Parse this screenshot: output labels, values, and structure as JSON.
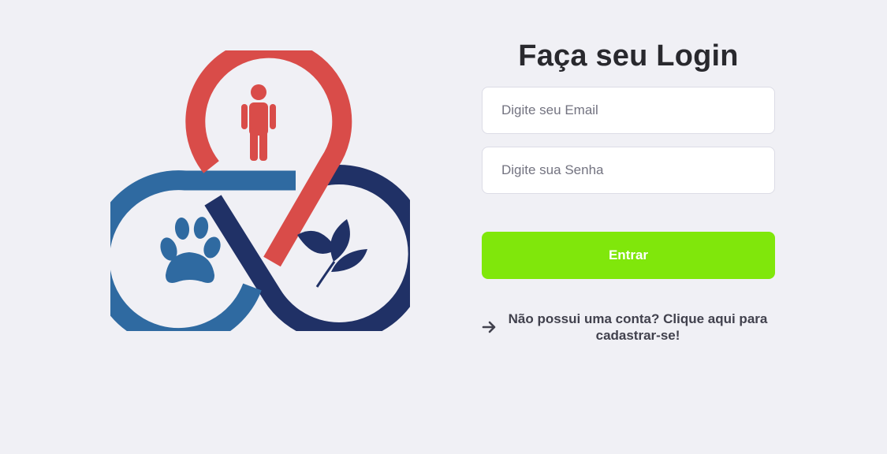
{
  "logo": {
    "icon": "triskelion-person-paw-leaf-logo",
    "colors": {
      "red": "#d94c49",
      "blue": "#2f6aa1",
      "navy": "#203166"
    }
  },
  "login": {
    "title": "Faça seu Login",
    "email_placeholder": "Digite seu Email",
    "password_placeholder": "Digite sua Senha",
    "submit_label": "Entrar",
    "register_link": "Não possui uma conta? Clique aqui para cadastrar-se!"
  },
  "colors": {
    "background": "#f0f0f5",
    "button": "#80e70b",
    "title": "#29292e"
  }
}
